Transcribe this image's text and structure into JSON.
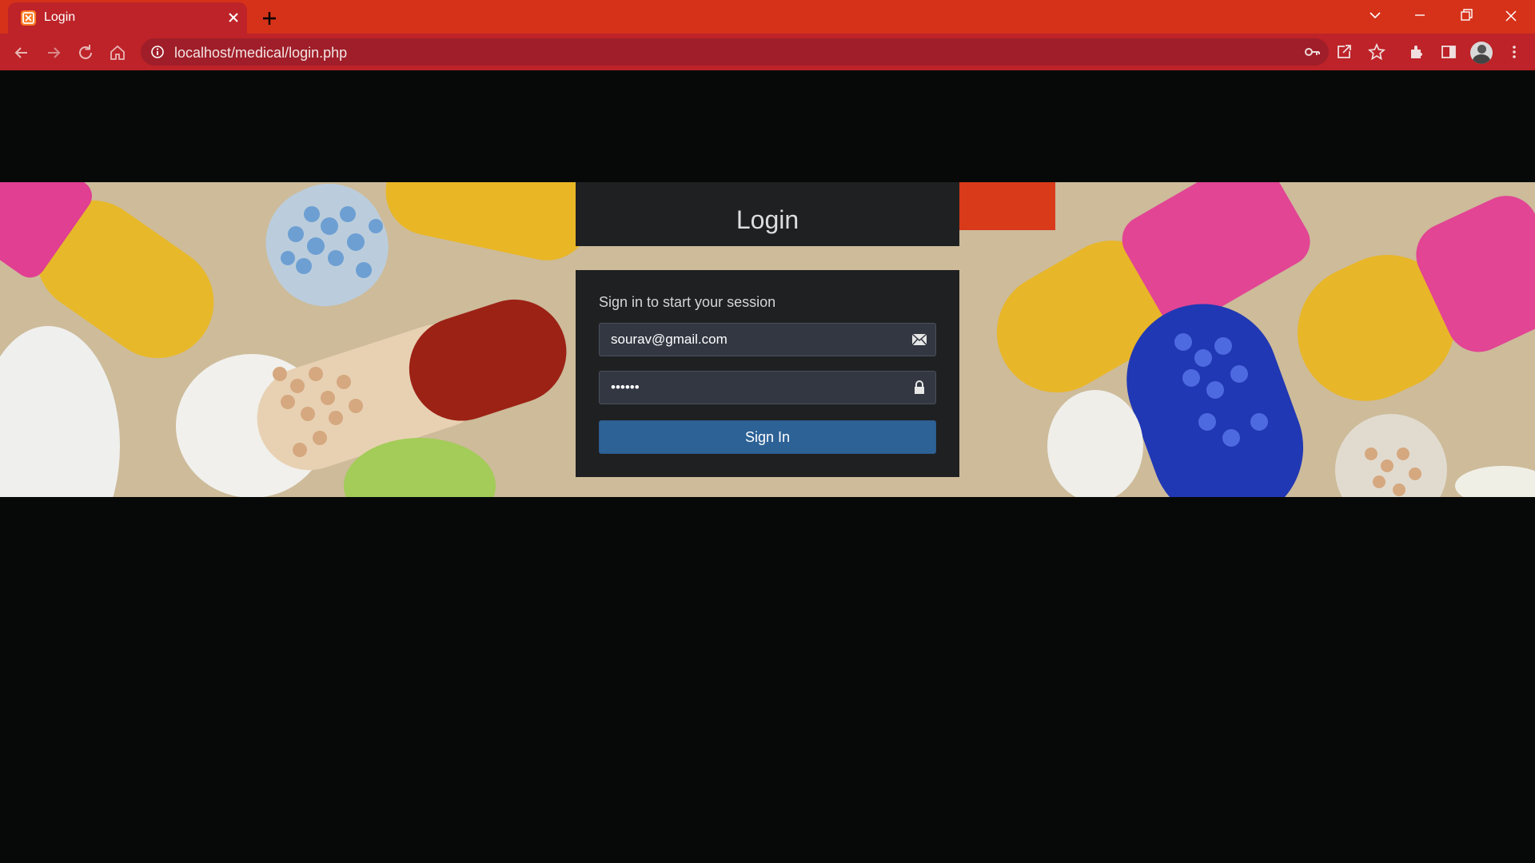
{
  "browser": {
    "tab_title": "Login",
    "url": "localhost/medical/login.php",
    "accent": "#d6321a"
  },
  "login": {
    "title": "Login",
    "message": "Sign in to start your session",
    "email_value": "sourav@gmail.com",
    "password_value": "••••••",
    "signin_label": "Sign In",
    "button_color": "#2d6296"
  },
  "banner": {
    "theme": "medical pills and capsules photo"
  }
}
